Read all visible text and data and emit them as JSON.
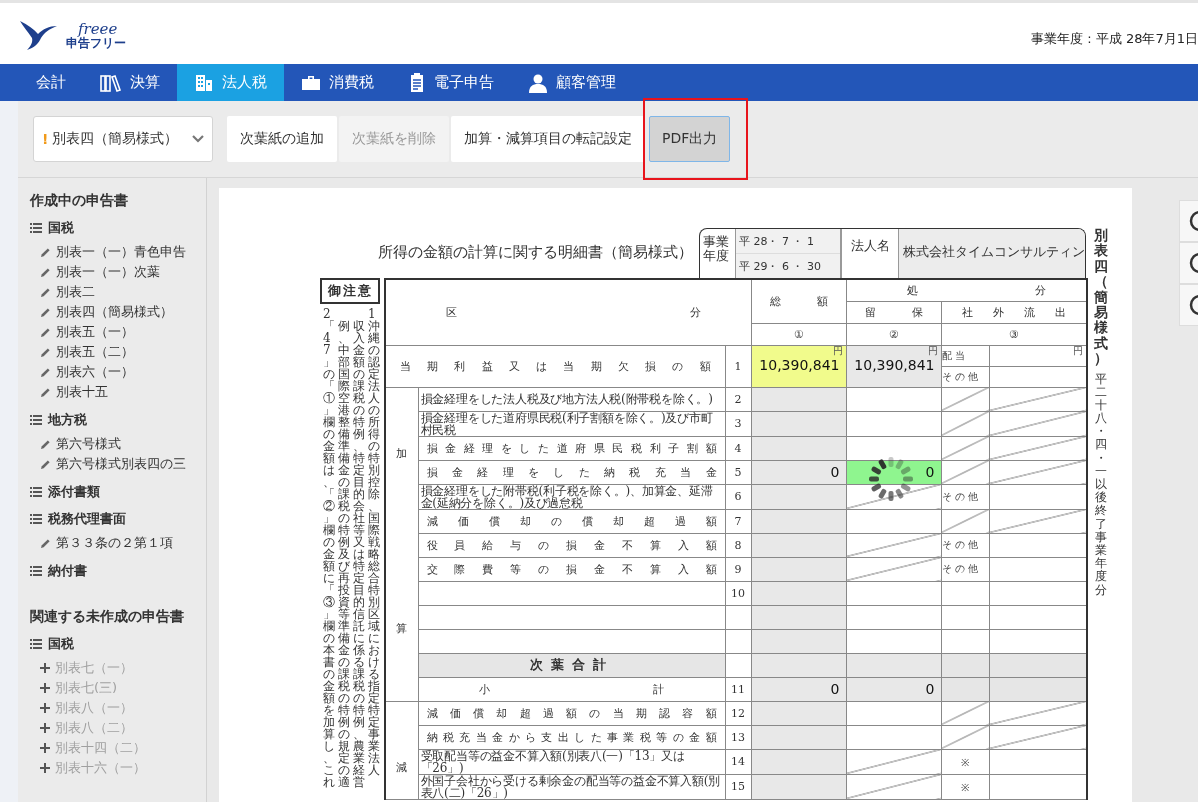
{
  "header": {
    "logo_script": "freee",
    "logo_name": "申告フリー",
    "fiscal_year": "事業年度 : 平成 28年7月1日"
  },
  "nav": [
    {
      "label": "会計",
      "kind": "text",
      "selected": false
    },
    {
      "label": "決算",
      "kind": "books",
      "selected": false
    },
    {
      "label": "法人税",
      "kind": "building",
      "selected": true
    },
    {
      "label": "消費税",
      "kind": "briefcase",
      "selected": false
    },
    {
      "label": "電子申告",
      "kind": "document",
      "selected": false
    },
    {
      "label": "顧客管理",
      "kind": "person",
      "selected": false
    }
  ],
  "toolbar": {
    "form_select": {
      "warning": "!",
      "value": "別表四（簡易様式）"
    },
    "buttons": [
      {
        "label": "次葉紙の追加",
        "disabled": false,
        "focused": false,
        "highlighted": false
      },
      {
        "label": "次葉紙を削除",
        "disabled": true,
        "focused": false,
        "highlighted": false
      },
      {
        "label": "加算・減算項目の転記設定",
        "disabled": false,
        "focused": false,
        "highlighted": false
      },
      {
        "label": "PDF出力",
        "disabled": false,
        "focused": true,
        "highlighted": true
      }
    ]
  },
  "sidebar": {
    "sections": [
      {
        "title": "作成中の申告書",
        "kind": "created",
        "groups": [
          {
            "title": "国税",
            "items": [
              "別表一（一）青色申告",
              "別表一（一）次葉",
              "別表二",
              "別表四（簡易様式）",
              "別表五（一）",
              "別表五（二）",
              "別表六（一）",
              "別表十五"
            ]
          },
          {
            "title": "地方税",
            "items": [
              "第六号様式",
              "第六号様式別表四の三"
            ]
          },
          {
            "title": "添付書類"
          },
          {
            "title": "税務代理書面",
            "items": [
              "第３３条の２第１項"
            ]
          },
          {
            "title": "納付書"
          }
        ]
      },
      {
        "title": "関連する未作成の申告書",
        "kind": "uncreated",
        "groups": [
          {
            "title": "国税",
            "items": [
              "別表七（一）",
              "別表七(三)",
              "別表八（一）",
              "別表八（二）",
              "別表十四（二）",
              "別表十六（一）"
            ]
          }
        ]
      }
    ]
  },
  "form": {
    "title": "所得の金額の計算に関する明細書（簡易様式）",
    "fiscal_year_label": "事業年度",
    "period_start": "平 28・ 7 ・ 1",
    "period_end": "平 29・ 6 ・ 30",
    "corp_label": "法人名",
    "corp_name": "株式会社タイムコンサルティン",
    "side_title": "別表四（簡易様式）",
    "side_note": "平二十八・四・一以後終了事業年度分",
    "caution_title": "御注意",
    "caution_columns": [
      "2「47」の「①」欄の金額は、「②」欄の金額に「③」欄の本書の金額を加算し、これ",
      "例、中部国際空港整備準備金の課税の特例及び再投資等準備金の課税の特例の規定の適",
      "収入金額の課税の特例、特定目的会社等又は特定目的信託に係る課税の特例、農業経営",
      "1沖縄の認定法人の所得の特別控除、国際戦略総合特別区域における指定特定事業法人"
    ],
    "headers": {
      "category": "区 分",
      "total": "総 額",
      "total_no": "①",
      "disposition": "処 分",
      "retained": "留 保",
      "outflow": "社 外 流 出",
      "retained_no": "②",
      "outflow_no": "③"
    },
    "first_row": {
      "label": "当期利益又は当期欠損の額",
      "no": "1",
      "total": {
        "kind": "focused",
        "value": "10,390,841",
        "unit": "円"
      },
      "retained": {
        "kind": "readonly",
        "value": "10,390,841",
        "unit": "円"
      },
      "outflow": [
        {
          "label": "配 当",
          "unit": "円"
        },
        {
          "label": "そ の 他"
        }
      ]
    },
    "loading": true,
    "groups": [
      {
        "side": [
          "加",
          "算"
        ],
        "rows": [
          {
            "kind": "item",
            "label": "損金経理をした法人税及び地方法人税(附帯税を除く。)",
            "no": "2",
            "retained": {
              "kind": "input",
              "struck": false
            },
            "outflow": {
              "kind": "struck"
            }
          },
          {
            "kind": "item",
            "label": "損金経理をした道府県民税(利子割額を除く。)及び市町村民税",
            "no": "3",
            "retained": {
              "kind": "input",
              "struck": false
            },
            "outflow": {
              "kind": "struck"
            }
          },
          {
            "kind": "item",
            "label": "損金経理をした道府県民税利子割額",
            "no": "4",
            "retained": {
              "kind": "input",
              "struck": false
            },
            "outflow": {
              "kind": "struck"
            }
          },
          {
            "kind": "item",
            "label": "損金経理をした納税充当金",
            "no": "5",
            "total": "0",
            "retained": {
              "kind": "active",
              "struck": false,
              "value": "0"
            },
            "outflow": {
              "kind": "struck"
            }
          },
          {
            "kind": "item",
            "label": "損金経理をした附帯税(利子税を除く。)、加算金、延滞金(延納分を除く。)及び過怠税",
            "no": "6",
            "retained": {
              "kind": "input",
              "struck": true
            },
            "outflow": {
              "kind": "other",
              "label": "そ の 他"
            }
          },
          {
            "kind": "item",
            "label": "減価償却の償却超過額",
            "no": "7",
            "retained": {
              "kind": "input",
              "struck": false
            },
            "outflow": {
              "kind": "struck"
            }
          },
          {
            "kind": "item",
            "label": "役員給与の損金不算入額",
            "no": "8",
            "retained": {
              "kind": "input",
              "struck": true
            },
            "outflow": {
              "kind": "other",
              "label": "そ の 他"
            }
          },
          {
            "kind": "item",
            "label": "交際費等の損金不算入額",
            "no": "9",
            "retained": {
              "kind": "input",
              "struck": true
            },
            "outflow": {
              "kind": "other",
              "label": "そ の 他"
            }
          },
          {
            "kind": "item",
            "no": "10",
            "retained": {
              "kind": "input",
              "struck": false
            },
            "outflow": {
              "kind": "blank"
            }
          },
          {
            "kind": "item",
            "retained": {
              "kind": "input",
              "struck": false
            },
            "outflow": {
              "kind": "blank"
            }
          },
          {
            "kind": "item",
            "retained": {
              "kind": "input",
              "struck": false
            },
            "outflow": {
              "kind": "blank"
            }
          },
          {
            "kind": "next",
            "label": "次葉合計",
            "retained": {
              "kind": "readonly",
              "struck": false
            },
            "outflow": {
              "kind": "readonly"
            }
          },
          {
            "kind": "subtotal",
            "label": "小 計",
            "no": "11",
            "total": "0",
            "retained": {
              "kind": "readonly",
              "struck": false,
              "value": "0"
            },
            "outflow": {
              "kind": "readonly"
            }
          }
        ]
      },
      {
        "side": [
          "減"
        ],
        "rows": [
          {
            "kind": "item",
            "label": "減価償却超過額の当期認容額",
            "no": "12",
            "retained": {
              "kind": "input",
              "struck": false
            },
            "outflow": {
              "kind": "struck"
            }
          },
          {
            "kind": "item",
            "label": "納税充当金から支出した事業税等の金額",
            "no": "13",
            "retained": {
              "kind": "input",
              "struck": false
            },
            "outflow": {
              "kind": "struck"
            }
          },
          {
            "kind": "item",
            "label": "受取配当等の益金不算入額(別表八(一)「13」又は「26」)",
            "no": "14",
            "retained": {
              "kind": "input",
              "struck": true
            },
            "outflow": {
              "kind": "mark",
              "label": "※"
            }
          },
          {
            "kind": "item",
            "label": "外国子会社から受ける剰余金の配当等の益金不算入額(別表八(二)「26」)",
            "no": "15",
            "retained": {
              "kind": "input",
              "struck": true
            },
            "outflow": {
              "kind": "mark",
              "label": "※"
            }
          }
        ]
      }
    ]
  }
}
